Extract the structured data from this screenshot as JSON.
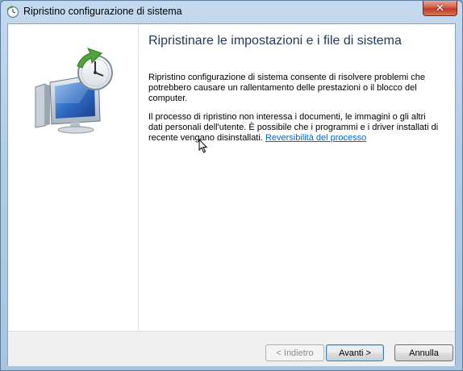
{
  "window": {
    "title": "Ripristino configurazione di sistema",
    "close_glyph": "✕"
  },
  "icons": {
    "title_icon": "system-restore-icon",
    "hero_icon": "system-restore-monitor-clock-icon"
  },
  "main": {
    "heading": "Ripristinare le impostazioni e i file di sistema",
    "paragraph1": "Ripristino configurazione di sistema consente di risolvere problemi che potrebbero causare un rallentamento delle prestazioni o il blocco del computer.",
    "paragraph2": "Il processo di ripristino non interessa i documenti, le immagini o gli altri dati personali dell'utente. È possibile che i programmi e i driver installati di recente vengano disinstallati.",
    "link_label": "Reversibilità del processo"
  },
  "footer": {
    "back_label": "< Indietro",
    "next_label": "Avanti >",
    "cancel_label": "Annulla"
  },
  "colors": {
    "heading": "#1e395b",
    "link": "#0066cc",
    "accent_arrow": "#4fa43a"
  }
}
